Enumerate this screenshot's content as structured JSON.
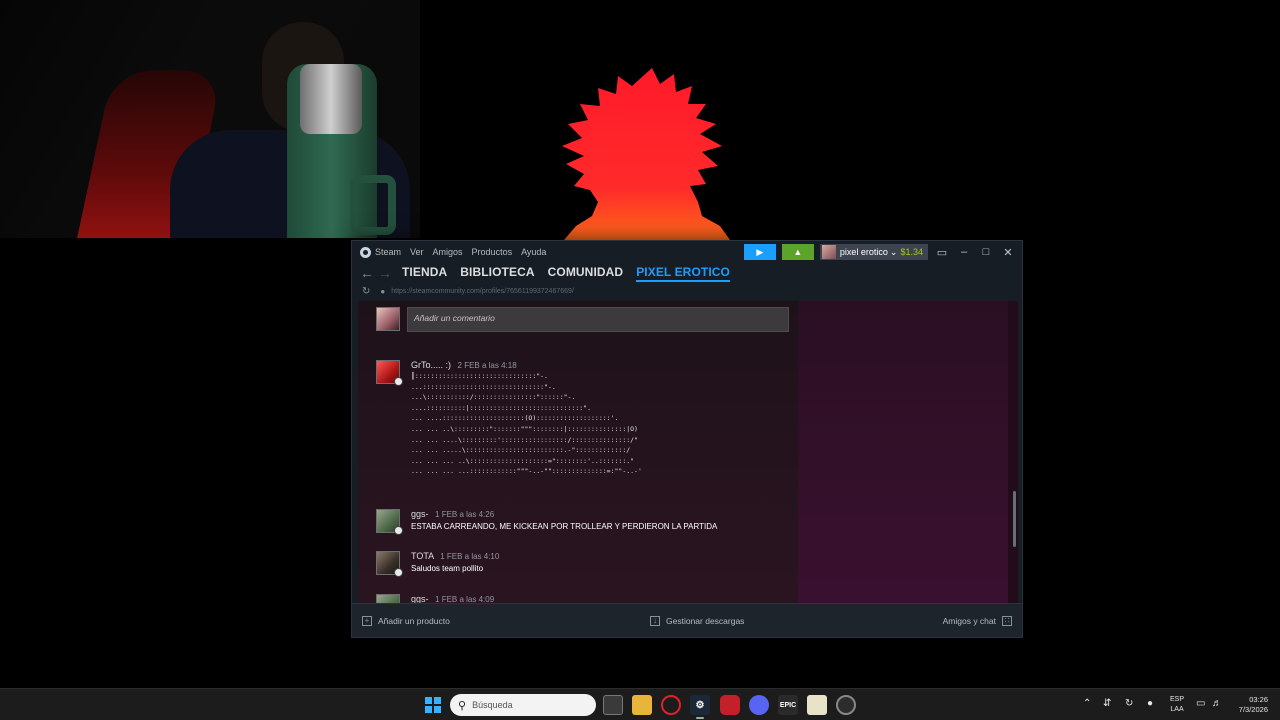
{
  "steam": {
    "menu": [
      "Steam",
      "Ver",
      "Amigos",
      "Productos",
      "Ayuda"
    ],
    "account_name": "pixel erotico",
    "balance": "$1.34",
    "nav_tabs": [
      {
        "label": "TIENDA",
        "active": false
      },
      {
        "label": "BIBLIOTECA",
        "active": false
      },
      {
        "label": "COMUNIDAD",
        "active": false
      },
      {
        "label": "PIXEL EROTICO",
        "active": true
      }
    ],
    "url": "https://steamcommunity.com/profiles/76561199372467669/",
    "comment_placeholder": "Añadir un comentario",
    "comments": [
      {
        "author": "GrTo..... :)",
        "timestamp": "2 FEB a las 4:18",
        "text": ""
      },
      {
        "author": "ggs-",
        "timestamp": "1 FEB a las 4:26",
        "text": "ESTABA CARREANDO, ME KICKEAN POR TROLLEAR Y PERDIERON LA PARTIDA"
      },
      {
        "author": "TOTA",
        "timestamp": "1 FEB a las 4:10",
        "text": "Saludos team pollito"
      },
      {
        "author": "ggs-",
        "timestamp": "1 FEB a las 4:09",
        "text": ""
      }
    ],
    "ascii_art": "┃:::::::::::::::::::::::::::::::\"-.\n...:::::::::::::::::::::::::::::::\"-.\n...\\:::::::::::/::::::::::::::::\"::::::\"-.\n....::::::::::|:::::::::::::::::::::::::::::\".\n... ....:::::::::::::::::::::(O):::::::::::::::::::'.\n... ... ..\\:::::::::\":::::::\"\"\"::::::::|:::::::::::::::|O)\n... ... ....\\:::::::::':::::::::::::::::/:::::::::::::::/\"\n... ... .....\\:::::::::::::::::::::::::.-\":::::::::::::/\n... ... ... ..\\::::::::::::::::::::=\"::::::::'..:::::::.\"\n... ... ... ...::::::::::::\"\"\"-..-\"\"::::::::::::::=:\"\"-..-'",
    "footer": {
      "add_product": "Añadir un producto",
      "downloads": "Gestionar descargas",
      "friends": "Amigos y chat"
    }
  },
  "taskbar": {
    "search_placeholder": "Búsqueda",
    "lang_top": "ESP",
    "lang_bottom": "LAA",
    "time": "03:26",
    "date": "7/3/2026"
  }
}
